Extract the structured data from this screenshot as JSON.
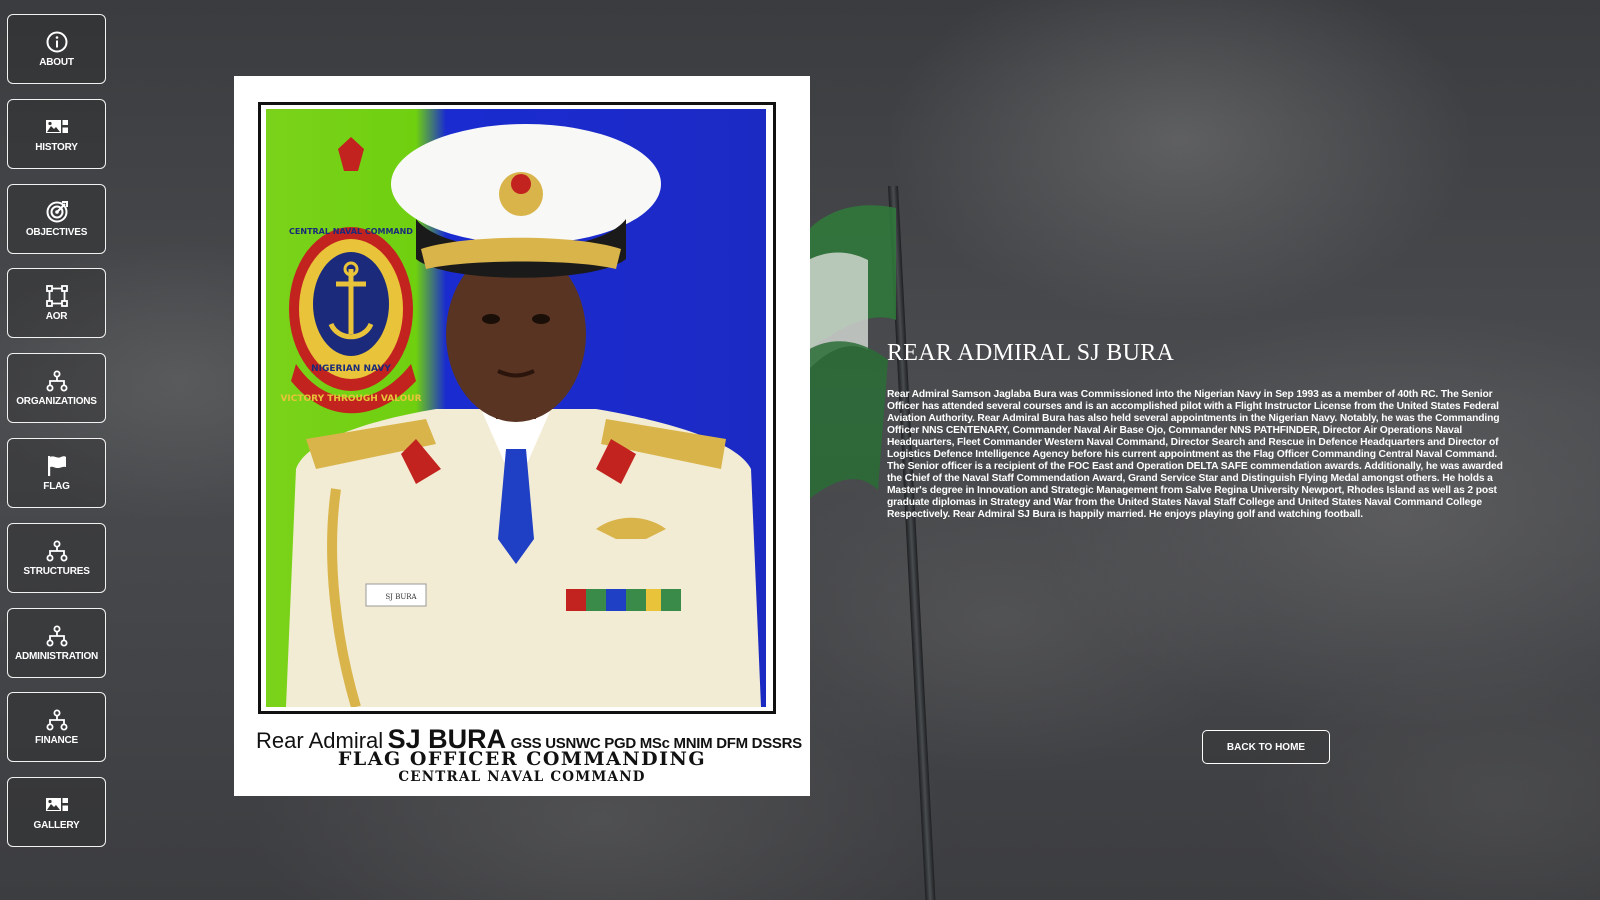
{
  "nav": {
    "items": [
      {
        "label": "ABOUT",
        "icon": "info-icon"
      },
      {
        "label": "HISTORY",
        "icon": "image-icon"
      },
      {
        "label": "OBJECTIVES",
        "icon": "target-icon"
      },
      {
        "label": "AOR",
        "icon": "nodes-icon"
      },
      {
        "label": "ORGANIZATIONS",
        "icon": "hierarchy-icon"
      },
      {
        "label": "FLAG",
        "icon": "flag-icon"
      },
      {
        "label": "STRUCTURES",
        "icon": "hierarchy-icon"
      },
      {
        "label": "ADMINISTRATION",
        "icon": "hierarchy-icon"
      },
      {
        "label": "FINANCE",
        "icon": "hierarchy-icon"
      },
      {
        "label": "GALLERY",
        "icon": "image-icon"
      }
    ]
  },
  "portrait": {
    "rank": "Rear Admiral",
    "name": "SJ BURA",
    "qualifications": "GSS  USNWC PGD MSc MNIM DFM DSSRS",
    "title_line": "FLAG OFFICER COMMANDING",
    "command_line": "CENTRAL NAVAL COMMAND",
    "crest_text_top": "CENTRAL NAVAL COMMAND",
    "crest_text_bottom": "NIGERIAN NAVY",
    "crest_motto": "VICTORY THROUGH VALOUR",
    "name_tag": "SJ BURA",
    "colors": {
      "green": "#6fd010",
      "blue": "#1c2ac4",
      "uniform": "#f3ecd4"
    }
  },
  "bio": {
    "title": "REAR ADMIRAL SJ BURA",
    "text": "Rear Admiral Samson Jaglaba Bura was Commissioned into the Nigerian Navy in Sep 1993 as a member of 40th RC. The Senior Officer has attended several courses and is an accomplished pilot with a Flight Instructor License from the United States Federal Aviation Authority. Rear Admiral Bura has also held several appointments in the Nigerian Navy. Notably, he was the Commanding Officer NNS CENTENARY, Commander Naval Air Base Ojo, Commander NNS PATHFINDER, Director Air Operations Naval Headquarters, Fleet Commander Western Naval Command, Director Search and Rescue in Defence Headquarters and Director of Logistics Defence Intelligence Agency before his current appointment as the Flag Officer Commanding Central Naval Command. The Senior officer is a recipient of the FOC East and Operation DELTA SAFE commendation awards. Additionally, he was awarded the Chief of the Naval Staff Commendation Award, Grand Service Star and Distinguish Flying Medal amongst others. He holds a Master's degree in Innovation and Strategic Management from Salve Regina University Newport, Rhodes Island as well as 2 post graduate diplomas in Strategy and War from the United States Naval Staff College and United States Naval Command College Respectively. Rear Admiral SJ Bura is happily married. He enjoys playing golf and watching football."
  },
  "back_button": {
    "label": "BACK TO HOME"
  }
}
